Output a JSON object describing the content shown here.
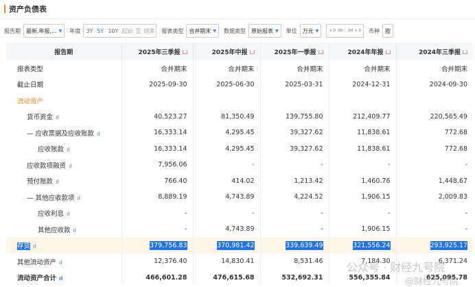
{
  "title": "资产负债表",
  "toolbar": {
    "period_label": "报告期",
    "period_value": "最新,年报,...",
    "year_label": "年度",
    "year_options": [
      "3Y",
      "5Y",
      "10Y"
    ],
    "year_selected": "5Y",
    "start_ph": "起始",
    "to": "至",
    "end_ph": "结束",
    "type_label": "报表类型",
    "type_value": "合并期末",
    "data_label": "数据类型",
    "data_value": "原始报表",
    "unit_label": "单位",
    "unit_value": "万元",
    "dec_inc": "+.0 .00",
    "dec_dec": ".00 +.0",
    "currency_label": "币种",
    "currency_value": "按"
  },
  "table": {
    "headers": [
      "报告期",
      "2025年三季报",
      "2025年中报",
      "2025年一季报",
      "2024年年报",
      "2024年三季报"
    ],
    "rows": [
      {
        "label": "报表类型",
        "indent": 1,
        "values": [
          "合并期末",
          "合并期末",
          "合并期末",
          "合并期末",
          "合并期末"
        ]
      },
      {
        "label": "截止日期",
        "indent": 1,
        "values": [
          "2025-09-30",
          "2025-06-30",
          "2025-03-31",
          "2024-12-31",
          "2024-09-30"
        ]
      },
      {
        "label": "流动资产",
        "indent": 1,
        "section": true,
        "values": [
          "",
          "",
          "",
          "",
          ""
        ]
      },
      {
        "label": "货币资金",
        "indent": 2,
        "chart": true,
        "values": [
          "40,523.27",
          "81,350.49",
          "139,755.80",
          "212,409.77",
          "220,565.49"
        ]
      },
      {
        "label": "— 应收票据及应收账款",
        "indent": 2,
        "chart": true,
        "values": [
          "16,333.14",
          "4,295.45",
          "39,327.62",
          "11,838.61",
          "772.68"
        ]
      },
      {
        "label": "应收账款",
        "indent": 3,
        "chart": true,
        "values": [
          "16,333.14",
          "4,295.45",
          "39,327.62",
          "11,838.61",
          "772.68"
        ]
      },
      {
        "label": "应收款项融资",
        "indent": 2,
        "chart": true,
        "values": [
          "7,956.06",
          "-",
          "-",
          "-",
          "-"
        ]
      },
      {
        "label": "预付账款",
        "indent": 2,
        "chart": true,
        "values": [
          "766.40",
          "414.02",
          "1,213.42",
          "1,460.76",
          "1,448.67"
        ]
      },
      {
        "label": "— 其他应收款项",
        "indent": 2,
        "chart": true,
        "values": [
          "8,889.19",
          "4,743.89",
          "4,224.52",
          "1,906.15",
          "2,009.83"
        ]
      },
      {
        "label": "应收利息",
        "indent": 3,
        "chart": true,
        "values": [
          "-",
          "-",
          "-",
          "-",
          "-"
        ]
      },
      {
        "label": "其他应收款",
        "indent": 3,
        "chart": true,
        "values": [
          "-",
          "4,743.89",
          "-",
          "1,906.15",
          "-"
        ]
      },
      {
        "label": "存货",
        "indent": 1,
        "chart": true,
        "highlight": true,
        "values": [
          "379,756.83",
          "370,981.42",
          "339,639.49",
          "321,556.24",
          "293,925.17"
        ]
      },
      {
        "label": "其他流动资产",
        "indent": 1,
        "chart": true,
        "values": [
          "12,376.40",
          "14,830.41",
          "8,531.46",
          "7,184.30",
          "6,371.24"
        ]
      },
      {
        "label": "流动资产合计",
        "indent": 1,
        "chart": true,
        "bold": true,
        "values": [
          "466,601.28",
          "476,615.68",
          "532,692.31",
          "556,355.84",
          "625,095.78"
        ]
      }
    ]
  },
  "watermark": {
    "text": "公众号 · 财经九号院",
    "sub": "@财经九号院"
  },
  "colors": {
    "accent": "#f08a24",
    "link": "#3a7bd5",
    "highlight": "#1e73e8"
  }
}
